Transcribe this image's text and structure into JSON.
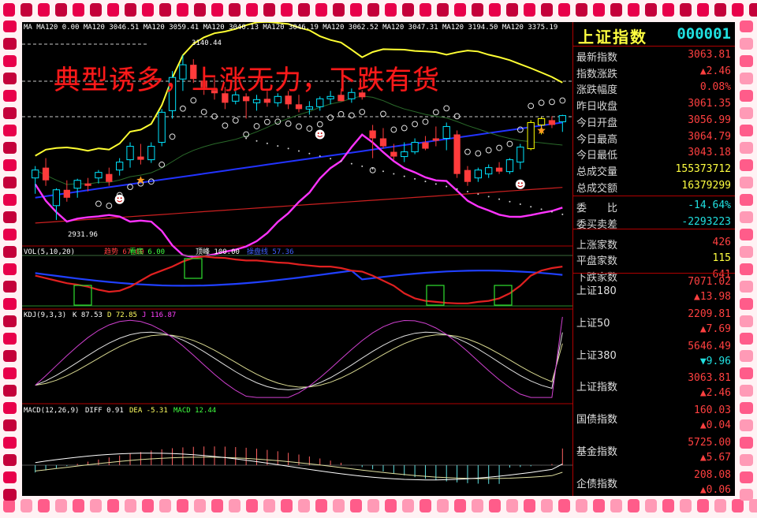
{
  "headline": "典型诱多，上涨无力，下跌有货",
  "main_chart": {
    "ma_label": "MA MA120 0.00  MA120 3046.51  MA120 3059.41  MA120 3040.13  MA120 3046.19  MA120 3062.52  MA120 3047.31  MA120 3194.50  MA120 3375.19",
    "high_label": "3140.44",
    "low_label": "2931.96"
  },
  "vol_panel": {
    "params": "VOL(5,10,20)",
    "trend_label": "趋势 67.00",
    "bottom_label": "看底 6.00",
    "top_label": "顶峰 100.00",
    "ops_label": "操盘线 57.36"
  },
  "kdj_panel": {
    "params": "KDJ(9,3,3)",
    "k": "K 87.53",
    "d": "D 72.85",
    "j": "J 116.87"
  },
  "macd_panel": {
    "params": "MACD(12,26,9)",
    "diff": "DIFF 0.91",
    "dea": "DEA -5.31",
    "macd": "MACD 12.44"
  },
  "colors": {
    "up": "#00e5ff",
    "down": "#ff3b3b",
    "yellow_candle": "#ffff00",
    "upper_band": "#ffff33",
    "lower_band": "#ff33ff",
    "ma_blue": "#2233ff",
    "ma_red": "#cc2020"
  },
  "quote_panel": {
    "title": "上证指数",
    "code": "000001",
    "rows": [
      {
        "label": "最新指数",
        "value": "3063.81"
      },
      {
        "label": "指数涨跌",
        "value": "▲2.46"
      },
      {
        "label": "涨跌幅度",
        "value": "0.08%"
      },
      {
        "label": "昨日收盘",
        "value": "3061.35"
      },
      {
        "label": "今日开盘",
        "value": "3056.99"
      },
      {
        "label": "今日最高",
        "value": "3064.79"
      },
      {
        "label": "今日最低",
        "value": "3043.18"
      },
      {
        "label": "总成交量",
        "value": "155373712"
      },
      {
        "label": "总成交额",
        "value": "16379299"
      },
      {
        "label": "委　　比",
        "value": "-14.64%"
      },
      {
        "label": "委买卖差",
        "value": "-2293223"
      },
      {
        "label": "上涨家数",
        "value": "426"
      },
      {
        "label": "平盘家数",
        "value": "115"
      },
      {
        "label": "下跌家数",
        "value": "641"
      }
    ],
    "indices": [
      {
        "label": "上证180",
        "value": "7071.02",
        "change": "▲13.98"
      },
      {
        "label": "上证50",
        "value": "2209.81",
        "change": "▲7.69"
      },
      {
        "label": "上证380",
        "value": "5646.49",
        "change": "▼9.96"
      },
      {
        "label": "上证指数",
        "value": "3063.81",
        "change": "▲2.46"
      },
      {
        "label": "国债指数",
        "value": "160.03",
        "change": "▲0.04"
      },
      {
        "label": "基金指数",
        "value": "5725.00",
        "change": "▲5.67"
      },
      {
        "label": "企债指数",
        "value": "208.08",
        "change": "▲0.06"
      }
    ]
  },
  "chart_data": {
    "type": "candlestick",
    "ylim": [
      2900,
      3170
    ],
    "candles": [
      {
        "o": 2985,
        "h": 3000,
        "l": 2965,
        "c": 2995
      },
      {
        "o": 2998,
        "h": 3010,
        "l": 2975,
        "c": 2982
      },
      {
        "o": 2950,
        "h": 2972,
        "l": 2931.96,
        "c": 2970
      },
      {
        "o": 2970,
        "h": 2982,
        "l": 2955,
        "c": 2960
      },
      {
        "o": 2972,
        "h": 2984,
        "l": 2960,
        "c": 2982
      },
      {
        "o": 2978,
        "h": 2985,
        "l": 2968,
        "c": 2975
      },
      {
        "o": 2985,
        "h": 2995,
        "l": 2978,
        "c": 2992
      },
      {
        "o": 2990,
        "h": 2998,
        "l": 2975,
        "c": 2980
      },
      {
        "o": 2995,
        "h": 3010,
        "l": 2988,
        "c": 3005
      },
      {
        "o": 3008,
        "h": 3030,
        "l": 2998,
        "c": 3025
      },
      {
        "o": 3012,
        "h": 3028,
        "l": 3002,
        "c": 3008
      },
      {
        "o": 3008,
        "h": 3030,
        "l": 3004,
        "c": 3025
      },
      {
        "o": 3030,
        "h": 3072,
        "l": 3025,
        "c": 3068
      },
      {
        "o": 3070,
        "h": 3120,
        "l": 3060,
        "c": 3112
      },
      {
        "o": 3110,
        "h": 3140.44,
        "l": 3095,
        "c": 3128
      },
      {
        "o": 3128,
        "h": 3135,
        "l": 3105,
        "c": 3110
      },
      {
        "o": 3108,
        "h": 3118,
        "l": 3090,
        "c": 3098
      },
      {
        "o": 3098,
        "h": 3112,
        "l": 3084,
        "c": 3092
      },
      {
        "o": 3092,
        "h": 3100,
        "l": 3072,
        "c": 3080
      },
      {
        "o": 3082,
        "h": 3095,
        "l": 3078,
        "c": 3090
      },
      {
        "o": 3088,
        "h": 3092,
        "l": 3060,
        "c": 3082
      },
      {
        "o": 3080,
        "h": 3090,
        "l": 3070,
        "c": 3084
      },
      {
        "o": 3085,
        "h": 3098,
        "l": 3075,
        "c": 3080
      },
      {
        "o": 3080,
        "h": 3092,
        "l": 3075,
        "c": 3088
      },
      {
        "o": 3089,
        "h": 3095,
        "l": 3072,
        "c": 3078
      },
      {
        "o": 3078,
        "h": 3090,
        "l": 3068,
        "c": 3072
      },
      {
        "o": 3072,
        "h": 3082,
        "l": 3065,
        "c": 3075
      },
      {
        "o": 3075,
        "h": 3088,
        "l": 3070,
        "c": 3085
      },
      {
        "o": 3085,
        "h": 3095,
        "l": 3078,
        "c": 3088
      },
      {
        "o": 3090,
        "h": 3098,
        "l": 3082,
        "c": 3082
      },
      {
        "o": 3085,
        "h": 3098,
        "l": 3080,
        "c": 3093
      },
      {
        "o": 3093,
        "h": 3096,
        "l": 3084,
        "c": 3087
      },
      {
        "o": 3045,
        "h": 3052,
        "l": 3010,
        "c": 3035
      },
      {
        "o": 3035,
        "h": 3048,
        "l": 3022,
        "c": 3025
      },
      {
        "o": 3018,
        "h": 3028,
        "l": 3008,
        "c": 3012
      },
      {
        "o": 3012,
        "h": 3030,
        "l": 3005,
        "c": 3018
      },
      {
        "o": 3018,
        "h": 3035,
        "l": 3015,
        "c": 3030
      },
      {
        "o": 3030,
        "h": 3038,
        "l": 3020,
        "c": 3022
      },
      {
        "o": 3035,
        "h": 3050,
        "l": 3025,
        "c": 3032
      },
      {
        "o": 3035,
        "h": 3055,
        "l": 3020,
        "c": 3050
      },
      {
        "o": 3040,
        "h": 3045,
        "l": 2985,
        "c": 2990
      },
      {
        "o": 2995,
        "h": 3000,
        "l": 2975,
        "c": 2980
      },
      {
        "o": 2985,
        "h": 2998,
        "l": 2980,
        "c": 2995
      },
      {
        "o": 2990,
        "h": 3002,
        "l": 2985,
        "c": 2998
      },
      {
        "o": 2998,
        "h": 3005,
        "l": 2990,
        "c": 2993
      },
      {
        "o": 2993,
        "h": 3010,
        "l": 2990,
        "c": 3008
      },
      {
        "o": 3005,
        "h": 3028,
        "l": 2996,
        "c": 3024
      },
      {
        "o": 3022,
        "h": 3058,
        "l": 3020,
        "c": 3055
      },
      {
        "o": 3052,
        "h": 3062,
        "l": 3040,
        "c": 3060
      },
      {
        "o": 3058,
        "h": 3063,
        "l": 3048,
        "c": 3052
      },
      {
        "o": 3056,
        "h": 3064.79,
        "l": 3043.18,
        "c": 3063.81
      }
    ]
  }
}
